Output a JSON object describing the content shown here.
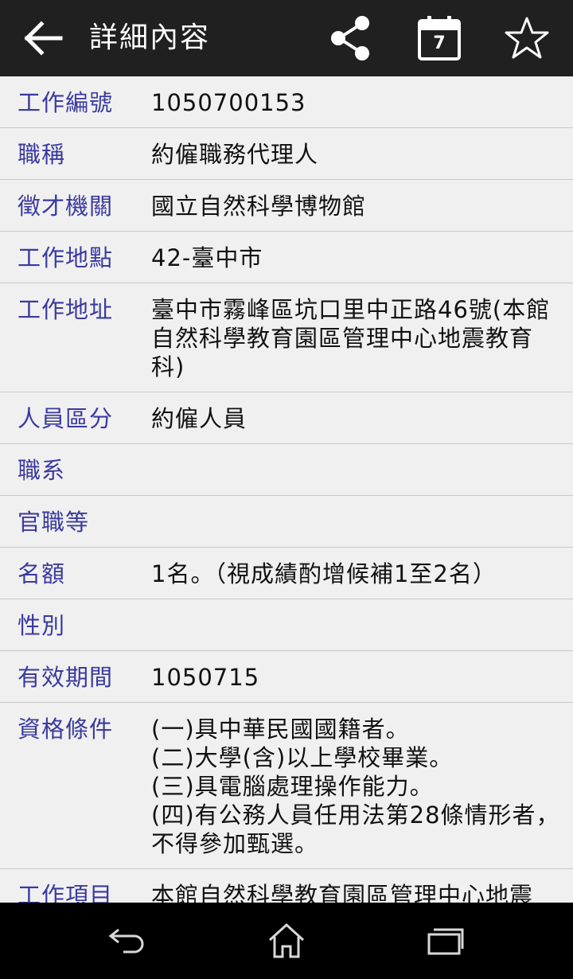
{
  "app_bar": {
    "title": "詳細內容",
    "icons": [
      "back-arrow-icon",
      "share-icon",
      "calendar-icon",
      "star-icon"
    ],
    "calendar_day": "7"
  },
  "details": [
    {
      "label": "工作編號",
      "value": "1050700153"
    },
    {
      "label": "職稱",
      "value": "約僱職務代理人"
    },
    {
      "label": "徵才機關",
      "value": "國立自然科學博物館"
    },
    {
      "label": "工作地點",
      "value": "42-臺中市"
    },
    {
      "label": "工作地址",
      "value": "臺中市霧峰區坑口里中正路46號(本館自然科學教育園區管理中心地震教育科)"
    },
    {
      "label": "人員區分",
      "value": "約僱人員"
    },
    {
      "label": "職系",
      "value": ""
    },
    {
      "label": "官職等",
      "value": ""
    },
    {
      "label": "名額",
      "value": "1名。（視成績酌增候補1至2名）"
    },
    {
      "label": "性別",
      "value": ""
    },
    {
      "label": "有效期間",
      "value": "1050715"
    },
    {
      "label": "資格條件",
      "value": "(一)具中華民國國籍者。\n(二)大學(含)以上學校畢業。\n(三)具電腦處理操作能力。\n(四)有公務人員任用法第28條情形者，不得參加甄選。"
    },
    {
      "label": "工作項目",
      "value": "本館自然科學教育園區管理中心地震"
    }
  ],
  "nav_bar": {
    "icons": [
      "back-nav-icon",
      "home-icon",
      "recents-icon"
    ]
  },
  "colors": {
    "app_bar_bg": "#202020",
    "label_text": "#3a3aa0",
    "row_bg": "#f0f0f0",
    "divider": "#c8c8c8",
    "nav_bg": "#000000"
  }
}
